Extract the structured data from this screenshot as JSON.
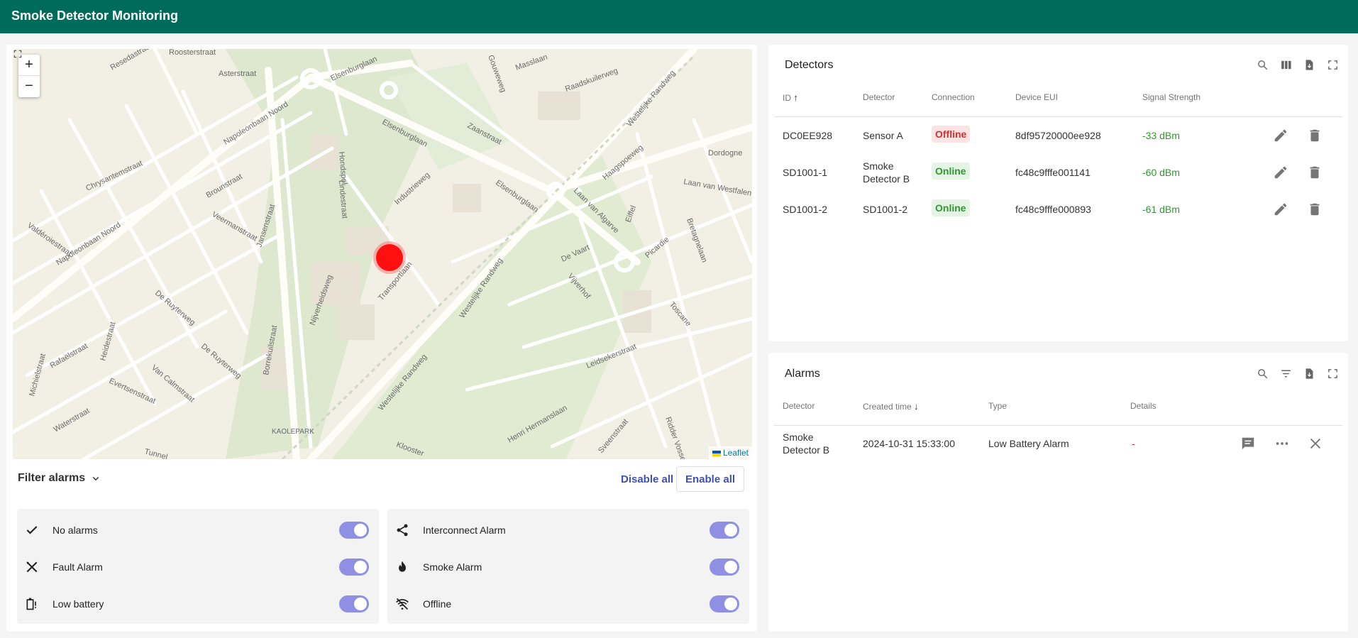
{
  "app": {
    "title": "Smoke Detector Monitoring"
  },
  "map": {
    "zoom_in": "+",
    "zoom_out": "−",
    "attribution": "Leaflet",
    "marker_color": "#ff1010",
    "streets": [
      "Elsenburglaan",
      "Napoleonbaan Noord",
      "Westelijke Randweg",
      "Laan van Algarve",
      "Industrieweg",
      "Transportlaan",
      "Zaanstraat",
      "Asterstraat",
      "Roosterstraat",
      "Brounstraat",
      "Veermanstraat",
      "Jansenstraat",
      "De Ruyterweg",
      "Nijverheidsweg",
      "Borrekuilstraat",
      "Van Calmstraat",
      "Heidestraat",
      "Evertsenstraat",
      "Waterstraat",
      "Tunnel",
      "KAOLEPARK",
      "Klooster",
      "Henri Hermanslaan",
      "Leidsekerstraat",
      "Picardie",
      "Toscane",
      "Dordogne",
      "Laan van Westfalen",
      "Haagspoeweg",
      "De Vaart",
      "Vijverhof",
      "Eiffel",
      "Bretagnelaan",
      "Raadskuilerweg",
      "Gouweweg",
      "Masslaan",
      "Ridder Vossen",
      "Sveenstraat",
      "Michielstraat",
      "Rafaëlstraat",
      "Valdéroiestraat",
      "Chrysantemstraat",
      "Resedastraat",
      "Hondspol",
      "Lindestraat"
    ]
  },
  "filter": {
    "title": "Filter alarms",
    "disable_all": "Disable all",
    "enable_all": "Enable all",
    "left": [
      {
        "label": "No alarms",
        "icon": "check-icon"
      },
      {
        "label": "Fault Alarm",
        "icon": "tools-icon"
      },
      {
        "label": "Low battery",
        "icon": "battery-alert-icon"
      }
    ],
    "right": [
      {
        "label": "Interconnect Alarm",
        "icon": "share-icon"
      },
      {
        "label": "Smoke Alarm",
        "icon": "fire-icon"
      },
      {
        "label": "Offline",
        "icon": "wifi-off-icon"
      }
    ],
    "toggle_color": "#8f8fe4"
  },
  "detectors": {
    "title": "Detectors",
    "columns": [
      "ID",
      "Detector",
      "Connection",
      "Device EUI",
      "Signal Strength"
    ],
    "rows": [
      {
        "id": "DC0EE928",
        "detector": "Sensor A",
        "connection": "Offline",
        "eui": "8df95720000ee928",
        "signal": "-33 dBm"
      },
      {
        "id": "SD1001-1",
        "detector": "Smoke Detector B",
        "detector_l1": "Smoke",
        "detector_l2": "Detector B",
        "connection": "Online",
        "eui": "fc48c9fffe001141",
        "signal": "-60 dBm"
      },
      {
        "id": "SD1001-2",
        "detector": "SD1001-2",
        "connection": "Online",
        "eui": "fc48c9fffe000893",
        "signal": "-61 dBm"
      }
    ]
  },
  "alarms": {
    "title": "Alarms",
    "columns": [
      "Detector",
      "Created time",
      "Type",
      "Details"
    ],
    "rows": [
      {
        "detector_l1": "Smoke",
        "detector_l2": "Detector B",
        "created": "2024-10-31 15:33:00",
        "type": "Low Battery Alarm",
        "details": "-"
      }
    ]
  },
  "colors": {
    "header": "#006b5b",
    "accent": "#3f51b5",
    "online": "#2e9a2e",
    "offline": "#d32f2f"
  }
}
